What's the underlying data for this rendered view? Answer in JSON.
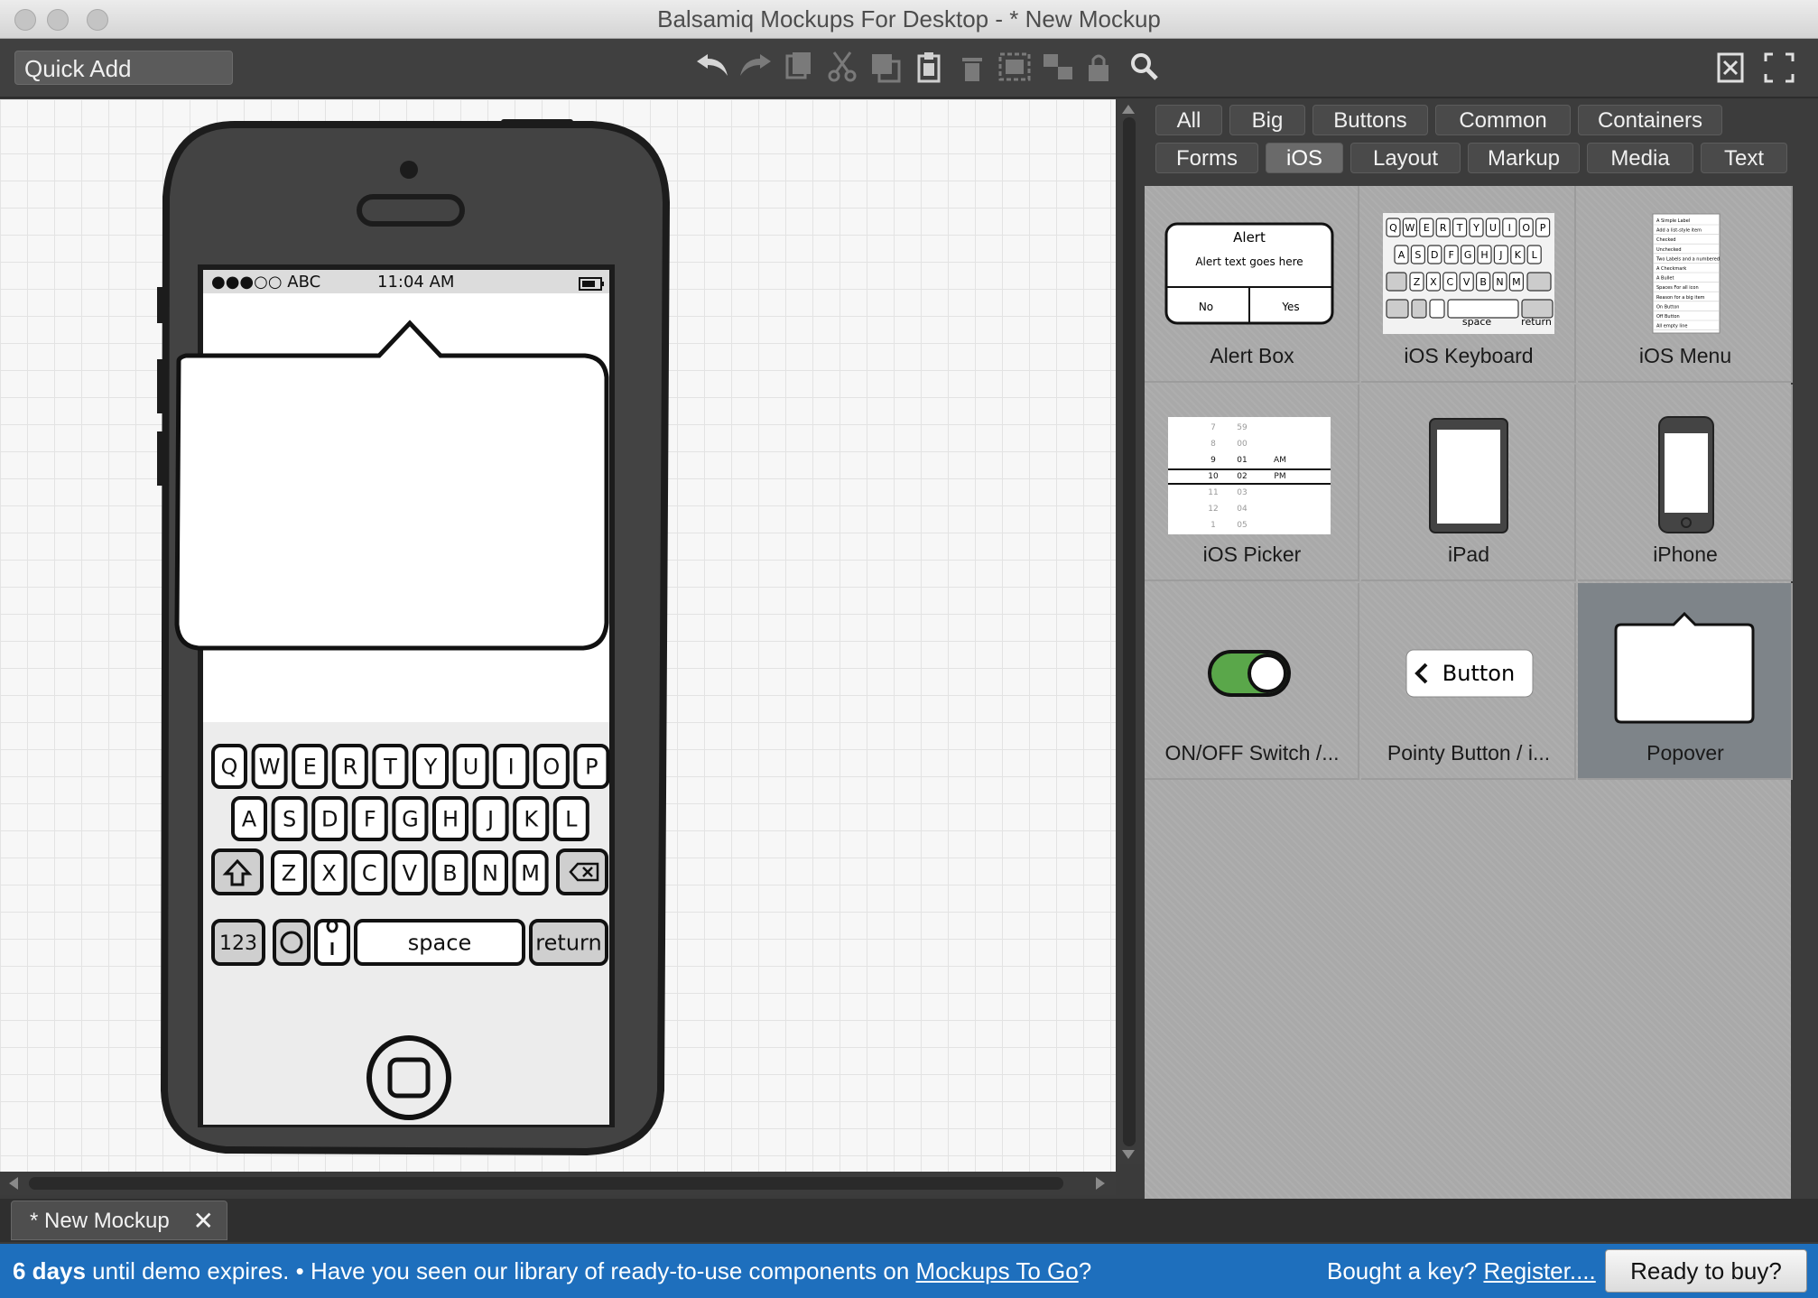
{
  "window": {
    "title": "Balsamiq Mockups For Desktop - * New Mockup"
  },
  "toolbar": {
    "quick_add_placeholder": "Quick Add",
    "tools": [
      "undo-icon",
      "redo-icon",
      "copy-icon",
      "cut-icon",
      "duplicate-icon",
      "paste-icon",
      "delete-icon",
      "group-icon",
      "ungroup-icon",
      "lock-icon",
      "search-icon"
    ],
    "right_tools": [
      "close-panel-icon",
      "fullscreen-icon"
    ]
  },
  "library": {
    "tabs_row1": [
      "All",
      "Big",
      "Buttons",
      "Common",
      "Containers"
    ],
    "tabs_row2": [
      "Forms",
      "iOS",
      "Layout",
      "Markup",
      "Media",
      "Text"
    ],
    "selected_tab": "iOS",
    "items": [
      "Alert Box",
      "iOS Keyboard",
      "iOS Menu",
      "iOS Picker",
      "iPad",
      "iPhone",
      "ON/OFF Switch /...",
      "Pointy Button / i...",
      "Popover"
    ],
    "selected_item": "Popover",
    "alert_preview": {
      "title": "Alert",
      "text": "Alert text goes here",
      "no": "No",
      "yes": "Yes"
    },
    "pointy_preview": {
      "label": "Button"
    },
    "keyboard_preview": {
      "space": "space",
      "return": "return"
    },
    "menu_preview": [
      "A Simple Label",
      "Add a list-style item",
      "Checked",
      "Unchecked",
      "Two Labels and a numbered",
      "A Checkmark",
      "A Bullet",
      "Spaces For all icon",
      "Reason for a big item",
      "On Button",
      "Off Button",
      "All empty line"
    ],
    "picker_preview": {
      "col1": [
        "7",
        "8",
        "9",
        "10",
        "11",
        "12",
        "1"
      ],
      "col2": [
        "59",
        "00",
        "01",
        "02",
        "03",
        "04",
        "05"
      ],
      "col3": [
        "AM",
        "PM"
      ]
    }
  },
  "mockup": {
    "carrier": "●●●○○ ABC",
    "time": "11:04 AM",
    "keyboard": {
      "row1": [
        "Q",
        "W",
        "E",
        "R",
        "T",
        "Y",
        "U",
        "I",
        "O",
        "P"
      ],
      "row2": [
        "A",
        "S",
        "D",
        "F",
        "G",
        "H",
        "J",
        "K",
        "L"
      ],
      "row3": [
        "Z",
        "X",
        "C",
        "V",
        "B",
        "N",
        "M"
      ],
      "num_key": "123",
      "space_key": "space",
      "return_key": "return"
    }
  },
  "tabs": {
    "document": "* New Mockup"
  },
  "banner": {
    "days": "6 days",
    "text": " until demo expires. • Have you seen our library of ready-to-use components on ",
    "link": "Mockups To Go",
    "question": "?",
    "key_text": "Bought a key? ",
    "register": "Register....",
    "ready_button": "Ready to buy?"
  }
}
